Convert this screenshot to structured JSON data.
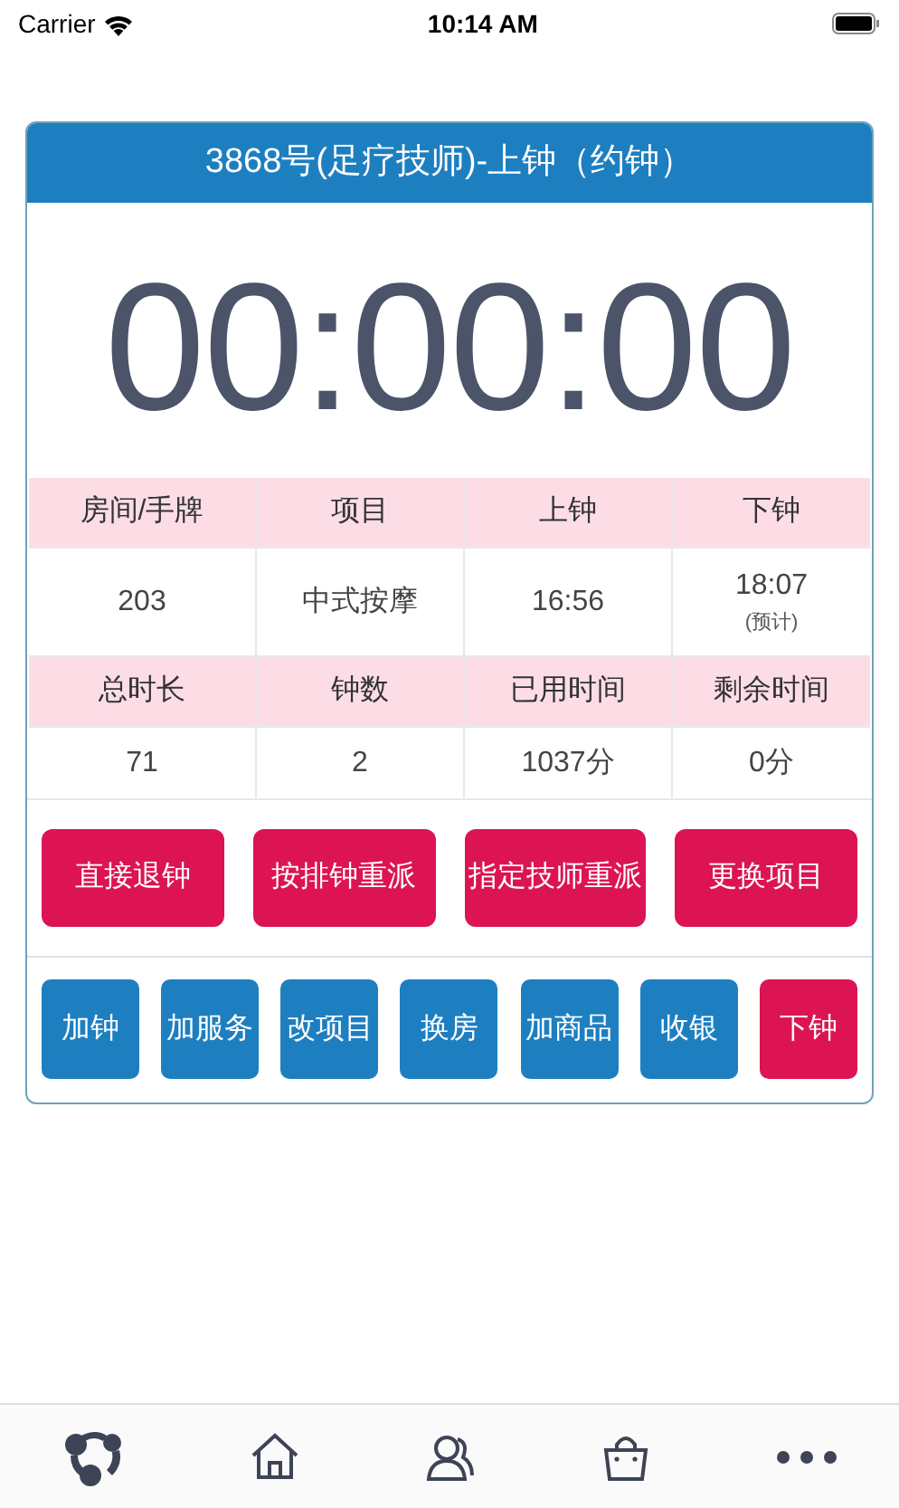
{
  "status_bar": {
    "carrier": "Carrier",
    "time": "10:14 AM"
  },
  "card": {
    "title": "3868号(足疗技师)-上钟（约钟）",
    "timer": "00:00:00",
    "table": [
      {
        "kind": "header",
        "cells": [
          {
            "text": "房间/手牌"
          },
          {
            "text": "项目"
          },
          {
            "text": "上钟"
          },
          {
            "text": "下钟"
          }
        ]
      },
      {
        "kind": "value",
        "cells": [
          {
            "text": "203"
          },
          {
            "text": "中式按摩"
          },
          {
            "text": "16:56"
          },
          {
            "text": "18:07",
            "note": "(预计)"
          }
        ]
      },
      {
        "kind": "header",
        "cells": [
          {
            "text": "总时长"
          },
          {
            "text": "钟数"
          },
          {
            "text": "已用时间"
          },
          {
            "text": "剩余时间"
          }
        ]
      },
      {
        "kind": "value",
        "cells": [
          {
            "text": "71"
          },
          {
            "text": "2"
          },
          {
            "text": "1037分"
          },
          {
            "text": "0分"
          }
        ]
      }
    ],
    "action_buttons": [
      {
        "label": "直接退钟",
        "kind": "danger"
      },
      {
        "label": "按排钟重派",
        "kind": "danger"
      },
      {
        "label": "指定技师重派",
        "kind": "danger"
      },
      {
        "label": "更换项目",
        "kind": "danger"
      }
    ],
    "quick_buttons": [
      {
        "label": "加钟",
        "kind": "primary"
      },
      {
        "label": "加服务",
        "kind": "primary"
      },
      {
        "label": "改项目",
        "kind": "primary"
      },
      {
        "label": "换房",
        "kind": "primary"
      },
      {
        "label": "加商品",
        "kind": "primary"
      },
      {
        "label": "收银",
        "kind": "primary"
      },
      {
        "label": "下钟",
        "kind": "danger"
      }
    ]
  }
}
